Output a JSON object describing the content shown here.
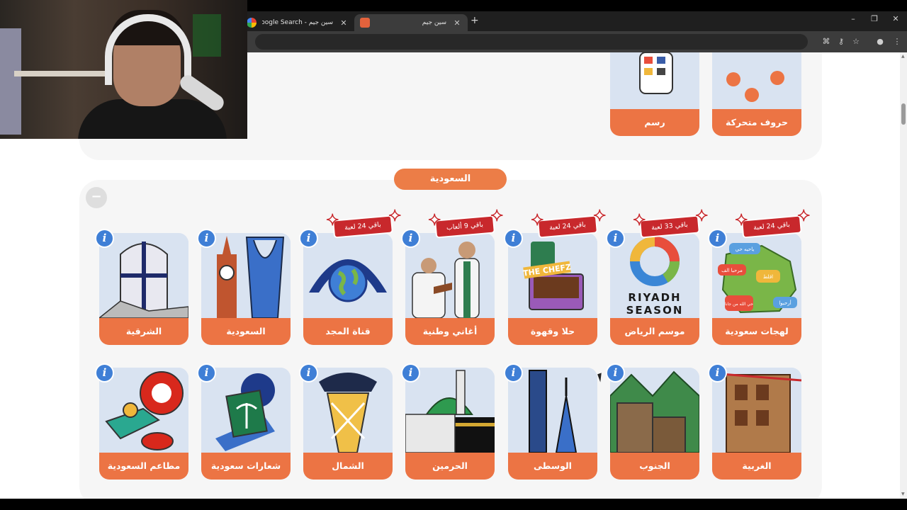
{
  "browser": {
    "tabs": [
      {
        "title": "سين جيم - Google Search",
        "favicon": "google-icon",
        "active": false
      },
      {
        "title": "سين جيم",
        "favicon": "game-icon",
        "active": true
      }
    ],
    "new_tab": "+",
    "controls": {
      "minimize": "–",
      "restore": "❐",
      "close": "✕"
    },
    "toolbar_icons": [
      "translate-icon",
      "key-icon",
      "star-icon",
      "extension-icon",
      "menu-icon"
    ]
  },
  "top_section": {
    "categories": [
      {
        "label": "رسم",
        "icon": "palette-icon"
      },
      {
        "label": "حروف متحركة",
        "icon": "letters-icon"
      }
    ]
  },
  "saudi_section": {
    "title": "السعودية",
    "collapse": "−",
    "info": "i",
    "row1": [
      {
        "label": "لهجات سعودية",
        "badge": "باقي 24 لعبة",
        "icon": "map-icon"
      },
      {
        "label": "موسم الرياض",
        "badge": "باقي 33 لعبة",
        "icon": "riyadh-season-logo",
        "logo_text": "RIYADH SEASON"
      },
      {
        "label": "حلا وقهوة",
        "badge": "باقي 24 لعبة",
        "icon": "coffee-icon",
        "logo_text": "THE CHEFZ"
      },
      {
        "label": "أغاني وطنية",
        "badge": "باقي 9 ألعاب",
        "icon": "singers-icon"
      },
      {
        "label": "قناة المجد",
        "badge": "باقي 24 لعبة",
        "icon": "globe-icon"
      },
      {
        "label": "السعودية",
        "badge": "",
        "icon": "tower-icon"
      },
      {
        "label": "الشرقية",
        "badge": "",
        "icon": "building-icon"
      }
    ],
    "row2": [
      {
        "label": "الغربية",
        "icon": "house-icon"
      },
      {
        "label": "الجنوب",
        "icon": "mountain-icon"
      },
      {
        "label": "الوسطى",
        "icon": "skyscraper-icon"
      },
      {
        "label": "الحرمين",
        "icon": "mosque-icon"
      },
      {
        "label": "الشمال",
        "icon": "tower2-icon"
      },
      {
        "label": "شعارات سعودية",
        "icon": "palm-emblem-icon"
      },
      {
        "label": "مطاعم السعودية",
        "icon": "food-icon"
      }
    ],
    "map_bubbles": [
      "ياحيه حي",
      "مرحبا الف",
      "اقلط",
      "أرحبوا",
      "حي الله من جانا"
    ]
  },
  "colors": {
    "accent": "#ec7444",
    "badge": "#c8282c",
    "info": "#3f7fd6",
    "panel": "#f6f6f6"
  }
}
